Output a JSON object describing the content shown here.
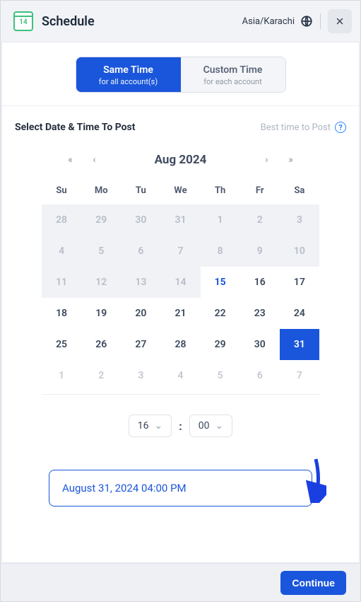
{
  "header": {
    "icon_day": "14",
    "title": "Schedule",
    "timezone": "Asia/Karachi"
  },
  "toggle": {
    "same": {
      "main": "Same Time",
      "sub": "for all account(s)"
    },
    "custom": {
      "main": "Custom Time",
      "sub": "for each account"
    }
  },
  "section": {
    "title": "Select Date & Time To Post",
    "best_time": "Best time to Post"
  },
  "calendar": {
    "month_label": "Aug  2024",
    "dow": [
      "Su",
      "Mo",
      "Tu",
      "We",
      "Th",
      "Fr",
      "Sa"
    ],
    "cells": [
      {
        "n": "28",
        "cls": "dim"
      },
      {
        "n": "29",
        "cls": "dim"
      },
      {
        "n": "30",
        "cls": "dim"
      },
      {
        "n": "31",
        "cls": "dim"
      },
      {
        "n": "1",
        "cls": "dim"
      },
      {
        "n": "2",
        "cls": "dim"
      },
      {
        "n": "3",
        "cls": "dim"
      },
      {
        "n": "4",
        "cls": "dim"
      },
      {
        "n": "5",
        "cls": "dim"
      },
      {
        "n": "6",
        "cls": "dim"
      },
      {
        "n": "7",
        "cls": "dim"
      },
      {
        "n": "8",
        "cls": "dim"
      },
      {
        "n": "9",
        "cls": "dim"
      },
      {
        "n": "10",
        "cls": "dim"
      },
      {
        "n": "11",
        "cls": "dim"
      },
      {
        "n": "12",
        "cls": "dim"
      },
      {
        "n": "13",
        "cls": "dim"
      },
      {
        "n": "14",
        "cls": "dim"
      },
      {
        "n": "15",
        "cls": "today"
      },
      {
        "n": "16",
        "cls": ""
      },
      {
        "n": "17",
        "cls": ""
      },
      {
        "n": "18",
        "cls": ""
      },
      {
        "n": "19",
        "cls": ""
      },
      {
        "n": "20",
        "cls": ""
      },
      {
        "n": "21",
        "cls": ""
      },
      {
        "n": "22",
        "cls": ""
      },
      {
        "n": "23",
        "cls": ""
      },
      {
        "n": "24",
        "cls": ""
      },
      {
        "n": "25",
        "cls": ""
      },
      {
        "n": "26",
        "cls": ""
      },
      {
        "n": "27",
        "cls": ""
      },
      {
        "n": "28",
        "cls": ""
      },
      {
        "n": "29",
        "cls": ""
      },
      {
        "n": "30",
        "cls": ""
      },
      {
        "n": "31",
        "cls": "selected"
      },
      {
        "n": "1",
        "cls": "faded"
      },
      {
        "n": "2",
        "cls": "faded"
      },
      {
        "n": "3",
        "cls": "faded"
      },
      {
        "n": "4",
        "cls": "faded"
      },
      {
        "n": "5",
        "cls": "faded"
      },
      {
        "n": "6",
        "cls": "faded"
      },
      {
        "n": "7",
        "cls": "faded"
      }
    ]
  },
  "time": {
    "hour": "16",
    "minute": "00"
  },
  "result": "August 31, 2024 04:00 PM",
  "footer": {
    "continue": "Continue"
  }
}
